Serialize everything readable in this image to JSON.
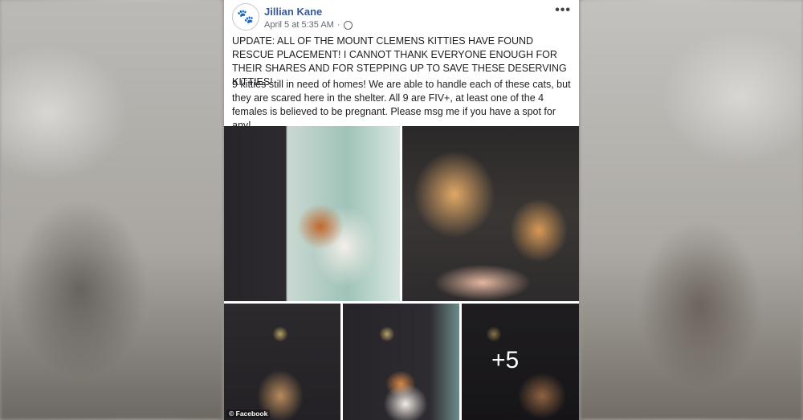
{
  "post": {
    "author": "Jillian Kane",
    "timestamp": "April 5 at 5:35 AM",
    "more_icon": "•••",
    "avatar_icon": "🐾",
    "paragraph1": "UPDATE: ALL OF THE MOUNT CLEMENS KITTIES HAVE FOUND RESCUE PLACEMENT! I CANNOT THANK EVERYONE ENOUGH FOR THEIR SHARES AND FOR STEPPING UP TO SAVE THESE DESERVING KITTIES!",
    "paragraph2": "9 kitties still in need of homes! We are able to handle each of these cats, but they are scared here in the shelter. All 9 are FIV+, at least one of the 4 females is believed to be pregnant. Please msg me if you have a spot for any!",
    "more_photos": "+5"
  },
  "credit": "© Facebook",
  "colors": {
    "author_link": "#385898",
    "meta_text": "#616770",
    "body_text": "#1c1e21"
  }
}
